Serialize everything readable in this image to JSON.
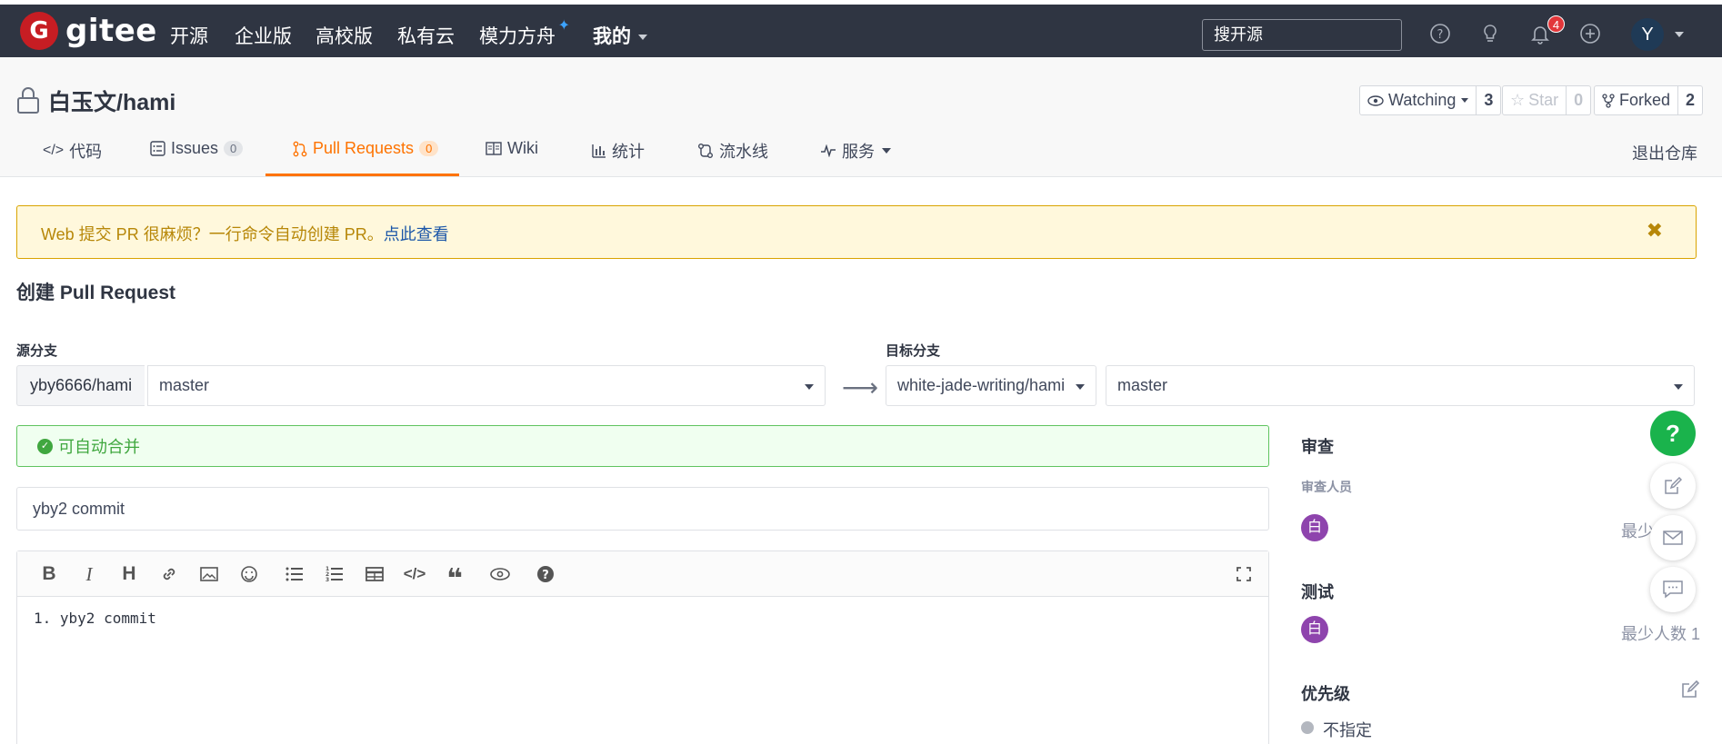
{
  "topnav": {
    "logo_mark": "G",
    "logo_text": "gitee",
    "items": [
      "开源",
      "企业版",
      "高校版",
      "私有云",
      "模力方舟"
    ],
    "mine_label": "我的",
    "search_placeholder": "搜开源",
    "notifications_count": "4",
    "avatar_letter": "Y"
  },
  "repo": {
    "title": "白玉文/hami",
    "watch_label": "Watching",
    "watch_count": "3",
    "star_label": "Star",
    "star_count": "0",
    "fork_label": "Forked",
    "fork_count": "2",
    "quit_label": "退出仓库"
  },
  "tabs": [
    {
      "label": "代码",
      "icon": "code-icon"
    },
    {
      "label": "Issues",
      "icon": "issues-icon",
      "count": "0"
    },
    {
      "label": "Pull Requests",
      "icon": "pull-request-icon",
      "count": "0",
      "active": true
    },
    {
      "label": "Wiki",
      "icon": "book-icon"
    },
    {
      "label": "统计",
      "icon": "bar-chart-icon"
    },
    {
      "label": "流水线",
      "icon": "pipeline-icon"
    },
    {
      "label": "服务",
      "icon": "pulse-icon"
    }
  ],
  "alert": {
    "text": "Web 提交 PR 很麻烦？一行命令自动创建 PR。",
    "link": "点此查看"
  },
  "form": {
    "page_title": "创建 Pull Request",
    "source_label": "源分支",
    "source_repo": "yby6666/hami",
    "source_branch": "master",
    "target_label": "目标分支",
    "target_repo": "white-jade-writing/hami",
    "target_branch": "master",
    "merge_status": "可自动合并",
    "pr_title": "yby2 commit",
    "body_text": "1. yby2 commit"
  },
  "sidebar": {
    "review_title": "审查",
    "reviewer_label": "审查人员",
    "reviewer_avatar": "白",
    "reviewer_min": "最少人数 1",
    "test_title": "测试",
    "tester_avatar": "白",
    "tester_min": "最少人数 1",
    "priority_title": "优先级",
    "priority_value": "不指定"
  },
  "colors": {
    "nav_bg": "#2f3542",
    "accent": "#fe7300",
    "success": "#40a73f",
    "brand_red": "#c71d23"
  }
}
